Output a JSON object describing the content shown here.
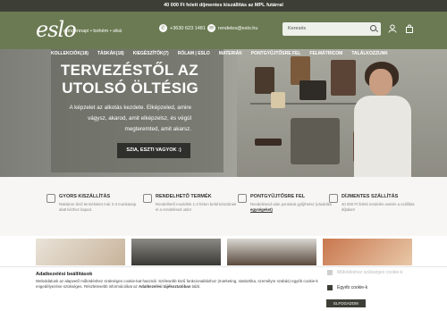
{
  "topbar": {
    "text": "40 000 Ft felett díjmentes kiszállítás az MPL futárral"
  },
  "header": {
    "logo": "eslo",
    "tagline": "mindennapi • bohém • siká",
    "phone": "+3630 623 1481",
    "email": "rendeles@eslo.hu",
    "search_placeholder": "Keresés"
  },
  "nav": {
    "items": [
      "KOLLEKCIÓK(18)",
      "TÁSKÁK(18)",
      "KIEGÉSZÍTŐK(7)",
      "RÓLAM | ESLO",
      "MATERIÁK",
      "PONTGYŰJTŐSRE FEL",
      "FELMÁTRICOM",
      "TALÁLKOZZUNK"
    ]
  },
  "hero": {
    "title": "TERVEZÉSTŐL AZ UTOLSÓ ÖLTÉSIG",
    "text": "A képzelet az alkotás kezdete. Elképzeled, amire vágysz, akarod, amit elképzelsz, és végül megteremted, amit akarsz.",
    "button": "SZIA, ESZTI VAGYOK :)"
  },
  "features": [
    {
      "title": "GYORS KISZÁLLÍTÁS",
      "desc": "Raktáron lévő termékeket már 2-3 munkanap alatt kézhez kapod.",
      "link": ""
    },
    {
      "title": "RENDELHETŐ TERMÉK",
      "desc": "Rendelhető modellek 1-3 héten belül készülnek el a rendelésed után!",
      "link": ""
    },
    {
      "title": "PONTGYŰJTŐSRE FEL",
      "desc": "Rendeléseid után pontokat gyűjthetsz (vásárlási ",
      "link": "egységeket)"
    },
    {
      "title": "DÍJMENTES SZÁLLÍTÁS",
      "desc": "40 000 Ft feletti rendelés esetén a szállítás díjtalan!",
      "link": ""
    }
  ],
  "cookie": {
    "heading": "Adatkezelési beállítások",
    "text_before": "Weboldalunk az alapvető működéshez szükséges cookie-kat használ. Szélesebb körű funkcionalitáshoz (marketing, statisztika, személyre szabás) egyéb cookie-k engedélyezése szükséges. Részletesebb információkat az ",
    "link": "Adatkezelési tájékoztatóban",
    "text_after": " talál.",
    "option_required": "Működéshez szükséges cookie-k",
    "option_other": "Egyéb cookie-k",
    "accept": "ELFOGADOM"
  },
  "colors": {
    "header": "#6b7a52",
    "topbar": "#3d3f36",
    "button": "#2f302c"
  }
}
